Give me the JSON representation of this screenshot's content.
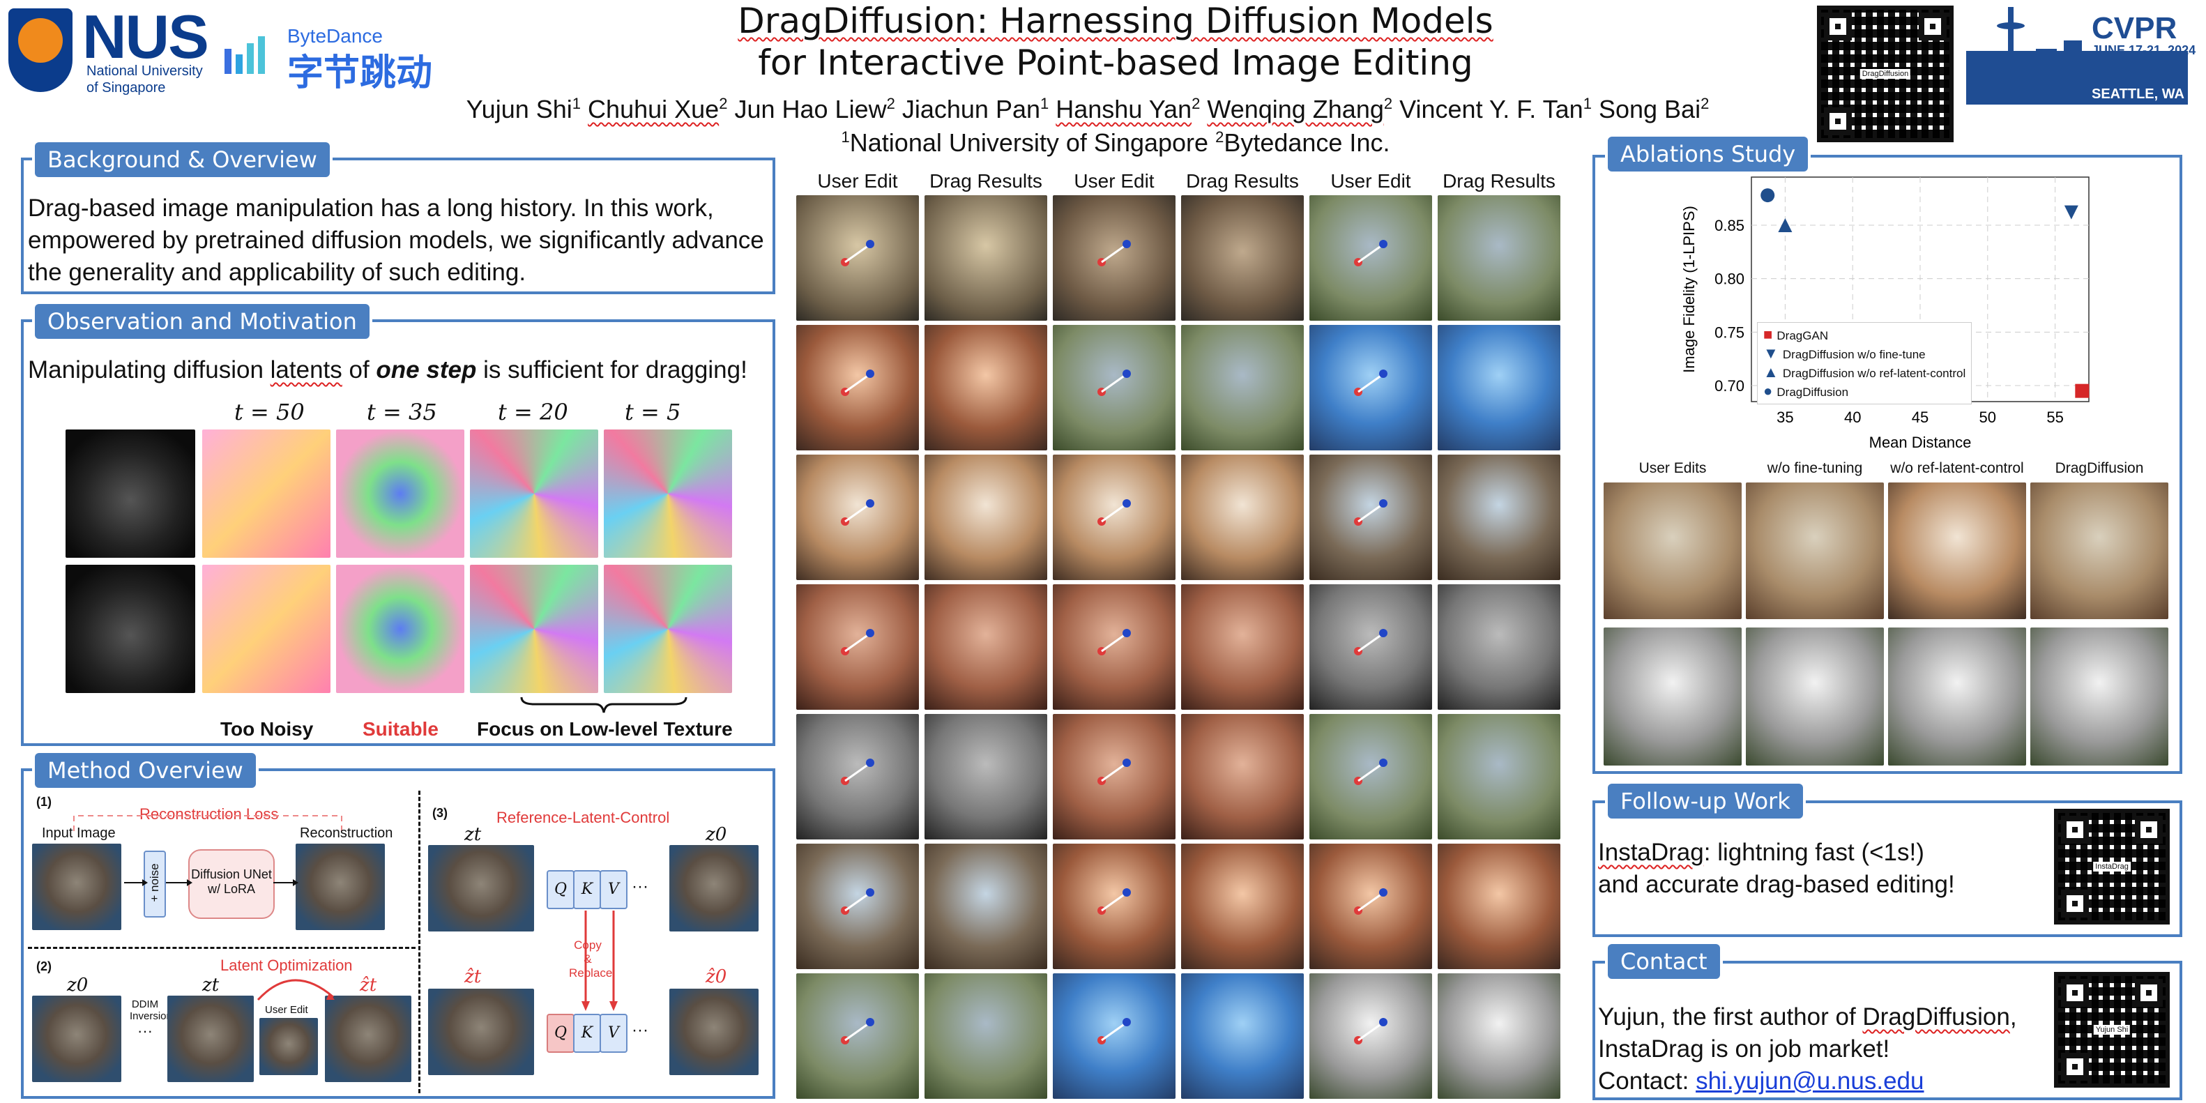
{
  "title": {
    "line1": "DragDiffusion: Harnessing Diffusion Models",
    "line2": "for Interactive Point-based Image Editing"
  },
  "authors": [
    {
      "name": "Yujun Shi",
      "aff": "1"
    },
    {
      "name": "Chuhui Xue",
      "aff": "2"
    },
    {
      "name": "Jun Hao Liew",
      "aff": "2"
    },
    {
      "name": "Jiachun Pan",
      "aff": "1"
    },
    {
      "name": "Hanshu Yan",
      "aff": "2"
    },
    {
      "name": "Wenqing Zhang",
      "aff": "2"
    },
    {
      "name": "Vincent Y. F. Tan",
      "aff": "1"
    },
    {
      "name": "Song Bai",
      "aff": "2"
    }
  ],
  "affiliations": [
    {
      "num": "1",
      "name": "National University of Singapore"
    },
    {
      "num": "2",
      "name": "Bytedance Inc."
    }
  ],
  "logos": {
    "nus_word": "NUS",
    "nus_sub1": "National University",
    "nus_sub2": "of Singapore",
    "bytedance_en": "ByteDance",
    "bytedance_cn": "字节跳动",
    "qr_main_caption": "DragDiffusion",
    "cvpr_title": "CVPR",
    "cvpr_dates": "JUNE 17-21, 2024",
    "cvpr_city": "SEATTLE, WA"
  },
  "background": {
    "heading": "Background & Overview",
    "text": "Drag-based image manipulation has a long history. In this work, empowered by pretrained diffusion models, we significantly advance the generality and applicability of such editing."
  },
  "observation": {
    "heading": "Observation and Motivation",
    "text_pre": "Manipulating diffusion ",
    "text_latents": "latents",
    "text_mid": " of ",
    "text_bold": "one step",
    "text_post": " is sufficient for dragging!",
    "timesteps": [
      "t = 50",
      "t = 35",
      "t = 20",
      "t = 5"
    ],
    "labels": {
      "noisy": "Too Noisy",
      "suitable": "Suitable",
      "texture": "Focus on Low-level Texture"
    }
  },
  "method": {
    "heading": "Method Overview",
    "p1": "(1)",
    "p2": "(2)",
    "p3": "(3)",
    "recon_loss": "Reconstruction Loss",
    "input_image": "Input Image",
    "noise": "+ noise",
    "unet1": "Diffusion UNet",
    "unet2": "w/ LoRA",
    "reconstruction": "Reconstruction",
    "ref_latent": "Reference-Latent-Control",
    "latent_opt": "Latent Optimization",
    "ddim1": "DDIM",
    "ddim2": "Inversion",
    "user_edit": "User Edit",
    "copy1": "Copy",
    "copy2": "&",
    "copy3": "Replace",
    "z0": "z0",
    "zt": "zt",
    "zt_hat": "ẑt",
    "z0_hat": "ẑ0",
    "q": "Q",
    "k": "K",
    "v": "V",
    "dots": "···"
  },
  "results": {
    "column_headers": [
      "User Edit",
      "Drag Results",
      "User Edit",
      "Drag Results",
      "User Edit",
      "Drag Results"
    ]
  },
  "ablation": {
    "heading": "Ablations Study",
    "image_headers": [
      "User Edits",
      "w/o fine-tuning",
      "w/o ref-latent-control",
      "DragDiffusion"
    ]
  },
  "chart_data": {
    "type": "scatter",
    "xlabel": "Mean Distance",
    "ylabel": "Image Fidelity (1-LPIPS)",
    "xlim": [
      32.5,
      57.5
    ],
    "ylim": [
      0.685,
      0.895
    ],
    "xticks": [
      "35",
      "40",
      "45",
      "50",
      "55"
    ],
    "yticks": [
      "0.70",
      "0.75",
      "0.80",
      "0.85"
    ],
    "grid": true,
    "legend_position": "lower-left",
    "series": [
      {
        "name": "DragGAN",
        "marker": "square",
        "color": "#d62728",
        "points": [
          [
            57.0,
            0.695
          ]
        ]
      },
      {
        "name": "DragDiffusion w/o fine-tune",
        "marker": "triangle-down",
        "color": "#1f4e8c",
        "points": [
          [
            56.2,
            0.862
          ]
        ]
      },
      {
        "name": "DragDiffusion w/o ref-latent-control",
        "marker": "triangle-up",
        "color": "#1f4e8c",
        "points": [
          [
            35.0,
            0.85
          ]
        ]
      },
      {
        "name": "DragDiffusion",
        "marker": "circle",
        "color": "#1f4e8c",
        "points": [
          [
            33.7,
            0.878
          ]
        ]
      }
    ]
  },
  "followup": {
    "heading": "Follow-up Work",
    "line1_link": "InstaDrag",
    "line1_rest": ": lightning fast (<1s!)",
    "line2": "and accurate drag-based editing!",
    "qr_caption": "InstaDrag"
  },
  "contact": {
    "heading": "Contact",
    "line1_pre": "Yujun, the first author of ",
    "line1_link": "DragDiffusion",
    "line1_post": ",",
    "line2": "InstaDrag is on job market!",
    "line3_pre": "Contact: ",
    "email": "shi.yujun@u.nus.edu",
    "qr_caption": "Yujun Shi"
  },
  "colors": {
    "accent": "#4a7fc1",
    "nus_blue": "#0b3c8c",
    "cvpr_blue": "#1f4d93",
    "highlight_red": "#e03a3a"
  }
}
